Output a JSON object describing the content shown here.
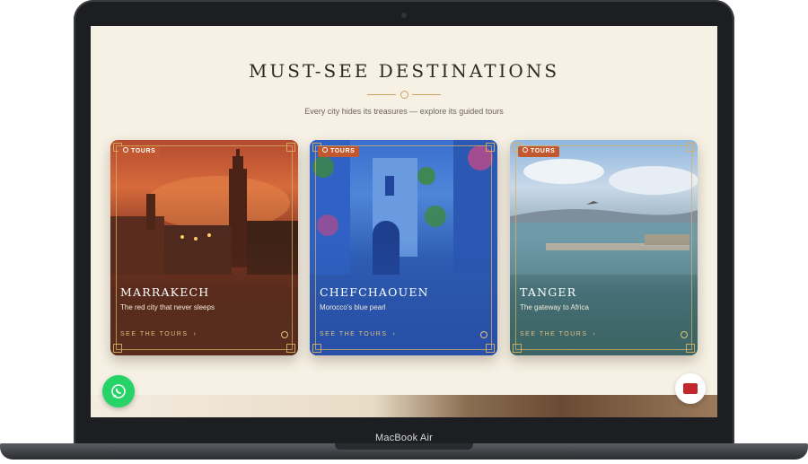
{
  "device": {
    "label": "MacBook Air"
  },
  "section": {
    "title": "MUST-SEE DESTINATIONS",
    "subtitle": "Every city hides its treasures — explore its guided tours"
  },
  "cards": [
    {
      "badge": "TOURS",
      "city": "MARRAKECH",
      "description": "The red city that never sleeps",
      "cta": "SEE THE TOURS"
    },
    {
      "badge": "TOURS",
      "city": "CHEFCHAOUEN",
      "description": "Morocco's blue pearl",
      "cta": "SEE THE TOURS"
    },
    {
      "badge": "TOURS",
      "city": "TANGER",
      "description": "The gateway to Africa",
      "cta": "SEE THE TOURS"
    }
  ],
  "icons": {
    "whatsapp": "whatsapp-icon",
    "language": "flag-icon",
    "arrow": "arrow-right-icon"
  },
  "colors": {
    "background": "#f6f1e4",
    "accent_gold": "#c8a35a",
    "badge": "#c2582f",
    "whatsapp": "#25d366"
  }
}
